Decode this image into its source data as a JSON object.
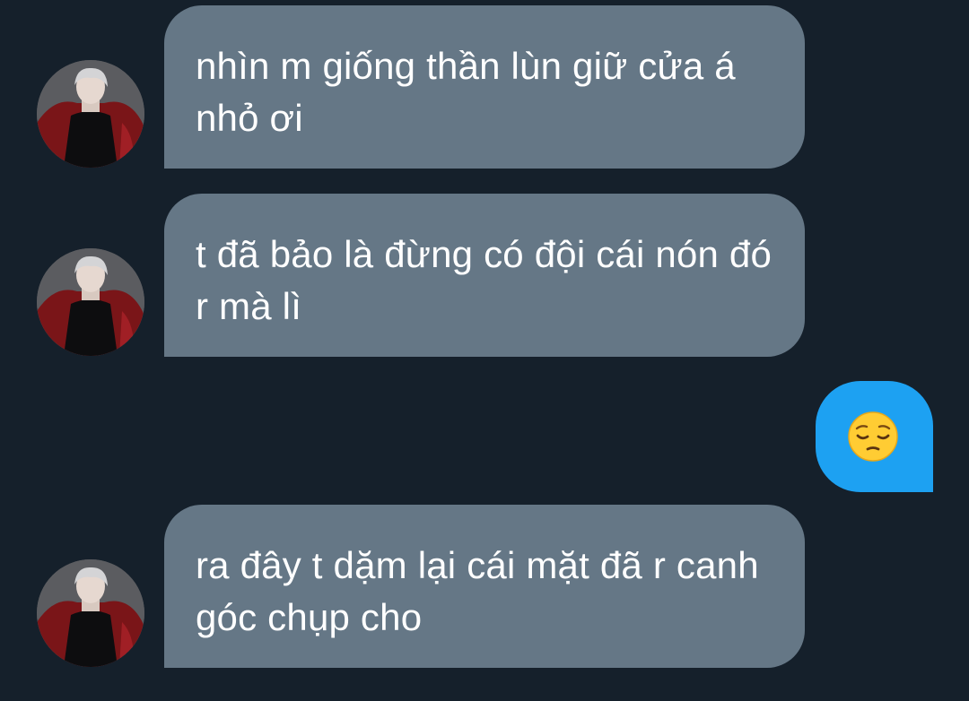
{
  "conversation": {
    "messages": [
      {
        "sender": "other",
        "text": "nhìn m giống thần lùn giữ cửa á nhỏ ơi"
      },
      {
        "sender": "other",
        "text": "t đã bảo là đừng có đội cái nón đó r mà lì"
      },
      {
        "sender": "me",
        "emoji_name": "pensive-face-emoji"
      },
      {
        "sender": "other",
        "text": "ra đây t dặm lại cái mặt đã r canh góc chụp cho"
      }
    ]
  },
  "colors": {
    "background": "#15202b",
    "incoming_bubble": "#657786",
    "outgoing_bubble": "#1da1f2",
    "text": "#ffffff"
  }
}
